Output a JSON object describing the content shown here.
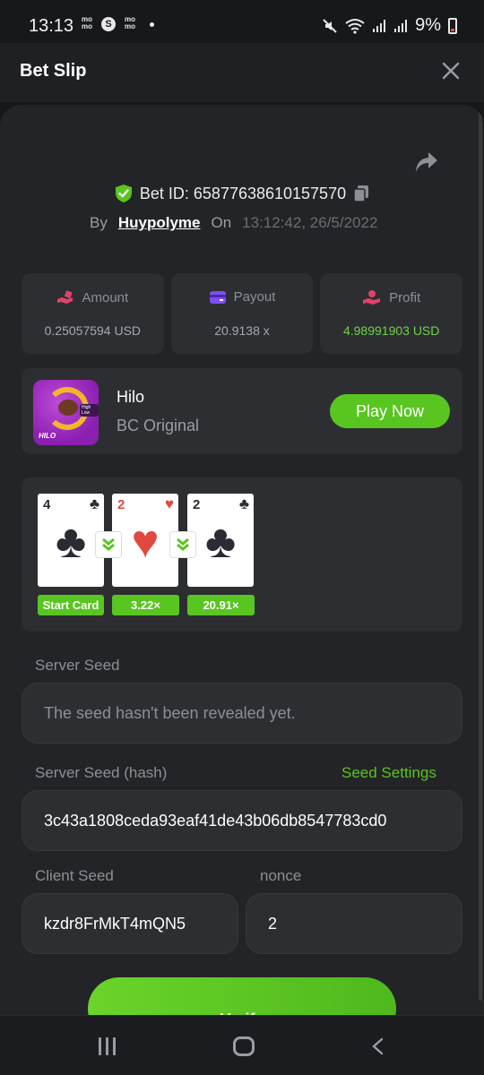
{
  "status_bar": {
    "time": "13:13",
    "app_icon_1": "mo\nmo",
    "app_icon_2": "S",
    "app_icon_3": "mo\nmo",
    "battery": "9%"
  },
  "header": {
    "title": "Bet Slip"
  },
  "bet": {
    "id_text": "Bet ID: 65877638610157570",
    "by_label": "By",
    "username": "Huypolyme",
    "on_label": "On",
    "datetime": "13:12:42, 26/5/2022"
  },
  "stats": [
    {
      "label": "Amount",
      "value": "0.25057594 USD",
      "icon": "amount-icon",
      "color": "#e0436a"
    },
    {
      "label": "Payout",
      "value": "20.9138 x",
      "icon": "wallet-icon",
      "color": "#7c4ff0"
    },
    {
      "label": "Profit",
      "value": "4.98991903 USD",
      "icon": "profit-hand-icon",
      "color": "#e0436a"
    }
  ],
  "game": {
    "name": "Hilo",
    "provider": "BC Original",
    "thumb_label": "HILO",
    "thumb_tag": "High Low",
    "play_label": "Play Now"
  },
  "cards": [
    {
      "rank": "4",
      "suit": "♣",
      "color": "black",
      "mult": "Start Card"
    },
    {
      "rank": "2",
      "suit": "♥",
      "color": "red",
      "mult": "3.22×"
    },
    {
      "rank": "2",
      "suit": "♣",
      "color": "black",
      "mult": "20.91×"
    }
  ],
  "seeds": {
    "server_seed_label": "Server Seed",
    "server_seed_value": "The seed hasn't been revealed yet.",
    "server_hash_label": "Server Seed (hash)",
    "seed_settings_label": "Seed Settings",
    "server_hash_value": "3c43a1808ceda93eaf41de43b06db8547783cd0",
    "client_seed_label": "Client Seed",
    "client_seed_value": "kzdr8FrMkT4mQN5",
    "nonce_label": "nonce",
    "nonce_value": "2"
  },
  "verify_label": "Verify",
  "colors": {
    "accent_green": "#59c521",
    "panel": "#232427",
    "card_bg": "#2d2e32"
  }
}
